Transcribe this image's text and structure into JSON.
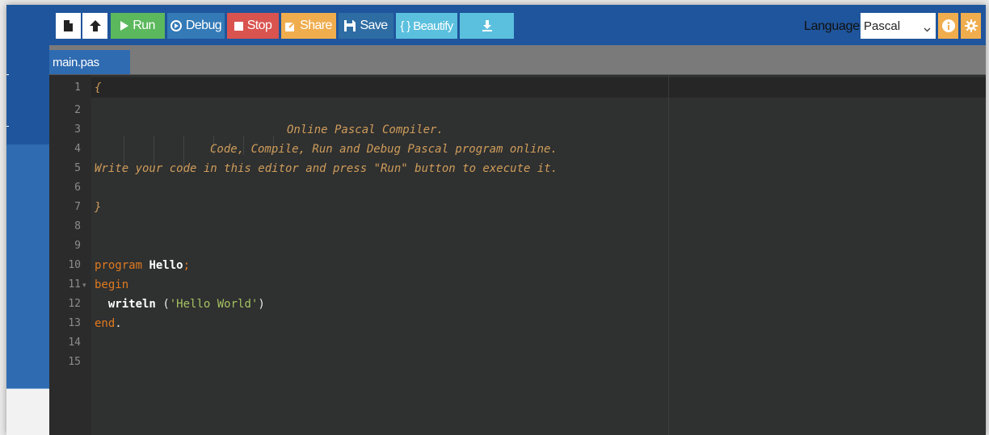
{
  "toolbar": {
    "new_file_icon": "file-icon",
    "upload_icon": "upload-icon",
    "run_label": "Run",
    "debug_label": "Debug",
    "stop_label": "Stop",
    "share_label": "Share",
    "save_label": "Save",
    "beautify_label": "{ } Beautify",
    "download_icon": "download-icon",
    "language_label": "Language",
    "language_value": "Pascal",
    "info_icon": "info-icon",
    "settings_icon": "gear-icon"
  },
  "tabs": [
    {
      "label": "main.pas",
      "active": true
    }
  ],
  "editor": {
    "line_numbers": [
      "1",
      "2",
      "3",
      "4",
      "5",
      "6",
      "7",
      "8",
      "9",
      "10",
      "11",
      "12",
      "13",
      "14",
      "15"
    ],
    "comment": {
      "open": "{",
      "line3": "Online Pascal Compiler.",
      "line4": "Code, Compile, Run and Debug Pascal program online.",
      "line5": "Write your code in this editor and press \"Run\" button to execute it.",
      "close": "}"
    },
    "code": {
      "program_kw": "program",
      "program_name": "Hello",
      "semicolon": ";",
      "begin_kw": "begin",
      "writeln": "writeln",
      "paren_open": "(",
      "string": "'Hello World'",
      "paren_close": ")",
      "end_kw": "end",
      "dot": "."
    }
  },
  "colors": {
    "toolbar_bg": "#1f559c",
    "run": "#5cb85c",
    "debug": "#337ab7",
    "stop": "#d9534f",
    "share": "#f0ad4e",
    "beautify": "#5bc0de",
    "editor_bg": "#2f3030",
    "comment": "#cf9d5a",
    "keyword": "#e07a1f",
    "string": "#a5c261"
  }
}
